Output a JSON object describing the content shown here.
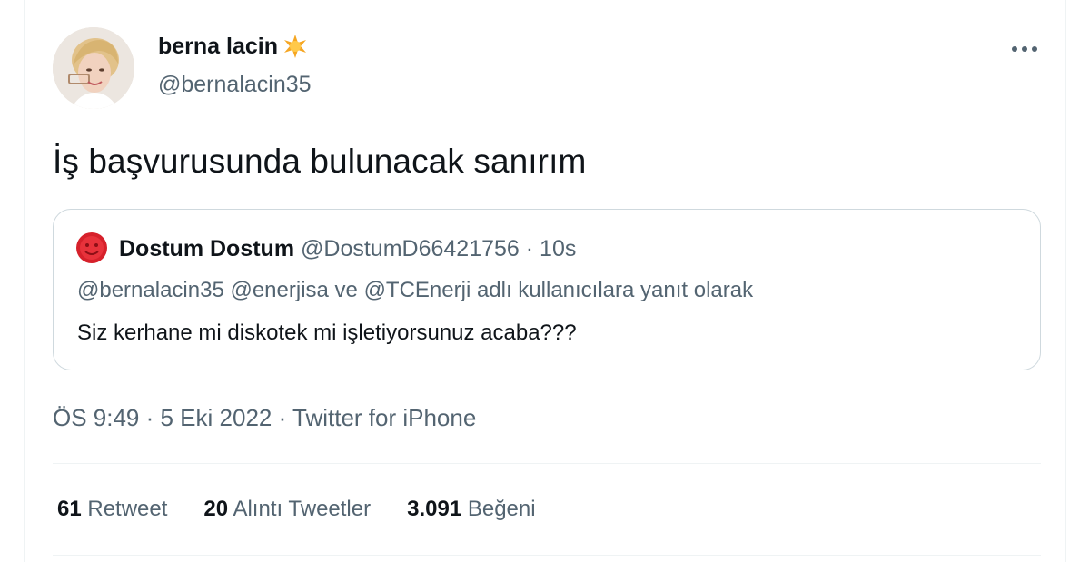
{
  "author": {
    "display_name": "berna lacin",
    "handle": "@bernalacin35",
    "badge_icon": "sun-star-icon"
  },
  "menu_icon": "more-horizontal-icon",
  "tweet": {
    "text": "İş başvurusunda bulunacak sanırım"
  },
  "quoted": {
    "display_name": "Dostum Dostum",
    "handle": "@DostumD66421756",
    "separator": "·",
    "time": "10s",
    "reply_prefix": "@bernalacin35 @enerjisa ve @TCEnerji adlı kullanıcılara yanıt olarak",
    "text": "Siz kerhane mi diskotek mi işletiyorsunuz acaba???"
  },
  "meta": {
    "timestamp": "ÖS 9:49 · 5 Eki 2022 · Twitter for iPhone"
  },
  "stats": [
    {
      "count": "61",
      "label": "Retweet"
    },
    {
      "count": "20",
      "label": "Alıntı Tweetler"
    },
    {
      "count": "3.091",
      "label": "Beğeni"
    }
  ],
  "colors": {
    "text_primary": "#0f1419",
    "text_secondary": "#536471",
    "border": "#cfd9de",
    "star": "#f5a623"
  }
}
